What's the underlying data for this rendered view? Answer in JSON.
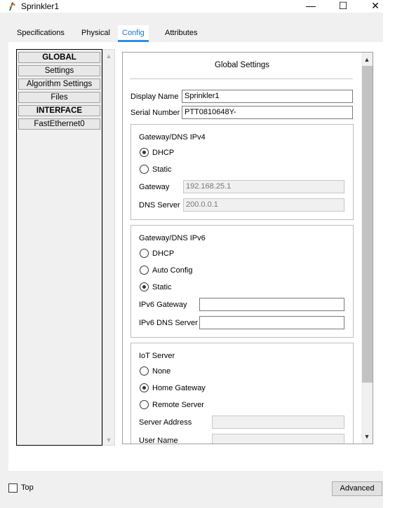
{
  "window": {
    "title": "Sprinkler1",
    "minimize": "—",
    "maximize": "☐",
    "close": "✕"
  },
  "tabs": [
    {
      "label": "Specifications"
    },
    {
      "label": "Physical"
    },
    {
      "label": "Config"
    },
    {
      "label": "Attributes"
    }
  ],
  "active_tab": "Config",
  "left_list": [
    {
      "label": "GLOBAL",
      "header": true
    },
    {
      "label": "Settings"
    },
    {
      "label": "Algorithm Settings"
    },
    {
      "label": "Files"
    },
    {
      "label": "INTERFACE",
      "header": true
    },
    {
      "label": "FastEthernet0"
    }
  ],
  "config": {
    "title": "Global Settings",
    "display_name": {
      "label": "Display Name",
      "value": "Sprinkler1"
    },
    "serial_number": {
      "label": "Serial Number",
      "value": "PTT0810648Y-"
    },
    "ipv4": {
      "title": "Gateway/DNS IPv4",
      "dhcp": "DHCP",
      "static": "Static",
      "selected": "DHCP",
      "gateway": {
        "label": "Gateway",
        "value": "192.168.25.1"
      },
      "dns": {
        "label": "DNS Server",
        "value": "200.0.0.1"
      }
    },
    "ipv6": {
      "title": "Gateway/DNS IPv6",
      "dhcp": "DHCP",
      "auto": "Auto Config",
      "static": "Static",
      "selected": "Static",
      "gateway": {
        "label": "IPv6 Gateway",
        "value": ""
      },
      "dns": {
        "label": "IPv6 DNS Server",
        "value": ""
      }
    },
    "iot": {
      "title": "IoT Server",
      "none": "None",
      "home": "Home Gateway",
      "remote": "Remote Server",
      "selected": "Home Gateway",
      "server_address": {
        "label": "Server Address",
        "value": ""
      },
      "user_name": {
        "label": "User Name",
        "value": ""
      }
    }
  },
  "scroll": {
    "up": "▲",
    "down": "▼"
  },
  "bottom": {
    "top_label": "Top",
    "top_checked": false,
    "advanced": "Advanced"
  },
  "colors": {
    "accent": "#2d8fe3",
    "active_tab_text": "#1e73c8"
  }
}
